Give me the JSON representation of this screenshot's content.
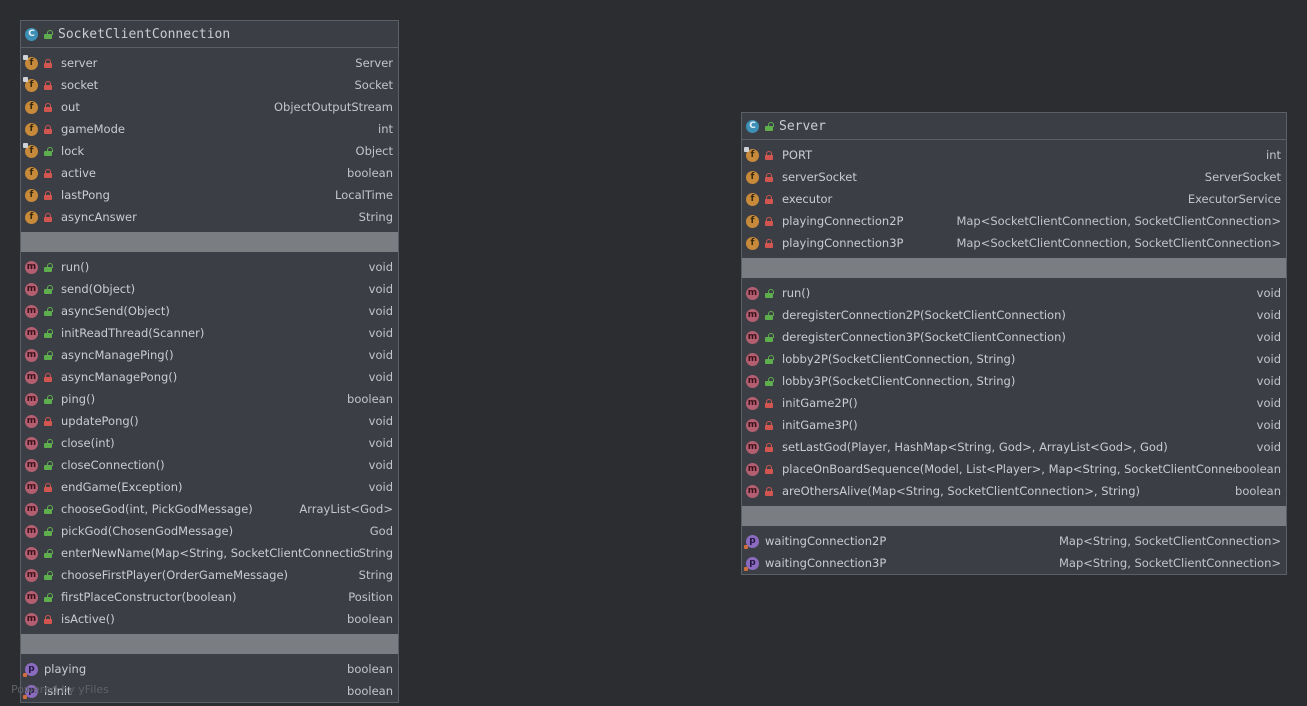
{
  "classes": [
    {
      "name": "SocketClientConnection",
      "fields": [
        {
          "name": "server",
          "type": "Server",
          "visibility": "private",
          "static": true
        },
        {
          "name": "socket",
          "type": "Socket",
          "visibility": "private",
          "static": true
        },
        {
          "name": "out",
          "type": "ObjectOutputStream",
          "visibility": "private"
        },
        {
          "name": "gameMode",
          "type": "int",
          "visibility": "private"
        },
        {
          "name": "lock",
          "type": "Object",
          "visibility": "public",
          "static": true
        },
        {
          "name": "active",
          "type": "boolean",
          "visibility": "private"
        },
        {
          "name": "lastPong",
          "type": "LocalTime",
          "visibility": "private"
        },
        {
          "name": "asyncAnswer",
          "type": "String",
          "visibility": "private"
        }
      ],
      "methods": [
        {
          "name": "run()",
          "type": "void",
          "visibility": "public"
        },
        {
          "name": "send(Object)",
          "type": "void",
          "visibility": "public"
        },
        {
          "name": "asyncSend(Object)",
          "type": "void",
          "visibility": "public"
        },
        {
          "name": "initReadThread(Scanner)",
          "type": "void",
          "visibility": "public"
        },
        {
          "name": "asyncManagePing()",
          "type": "void",
          "visibility": "public"
        },
        {
          "name": "asyncManagePong()",
          "type": "void",
          "visibility": "private"
        },
        {
          "name": "ping()",
          "type": "boolean",
          "visibility": "public"
        },
        {
          "name": "updatePong()",
          "type": "void",
          "visibility": "private"
        },
        {
          "name": "close(int)",
          "type": "void",
          "visibility": "public"
        },
        {
          "name": "closeConnection()",
          "type": "void",
          "visibility": "public"
        },
        {
          "name": "endGame(Exception)",
          "type": "void",
          "visibility": "private"
        },
        {
          "name": "chooseGod(int, PickGodMessage)",
          "type": "ArrayList<God>",
          "visibility": "public"
        },
        {
          "name": "pickGod(ChosenGodMessage)",
          "type": "God",
          "visibility": "public"
        },
        {
          "name": "enterNewName(Map<String, SocketClientConnection>)",
          "type": "String",
          "visibility": "public"
        },
        {
          "name": "chooseFirstPlayer(OrderGameMessage)",
          "type": "String",
          "visibility": "public"
        },
        {
          "name": "firstPlaceConstructor(boolean)",
          "type": "Position",
          "visibility": "public"
        },
        {
          "name": "isActive()",
          "type": "boolean",
          "visibility": "private"
        }
      ],
      "properties": [
        {
          "name": "playing",
          "type": "boolean"
        },
        {
          "name": "isInit",
          "type": "boolean"
        }
      ]
    },
    {
      "name": "Server",
      "fields": [
        {
          "name": "PORT",
          "type": "int",
          "visibility": "private",
          "static": true
        },
        {
          "name": "serverSocket",
          "type": "ServerSocket",
          "visibility": "private"
        },
        {
          "name": "executor",
          "type": "ExecutorService",
          "visibility": "private"
        },
        {
          "name": "playingConnection2P",
          "type": "Map<SocketClientConnection, SocketClientConnection>",
          "visibility": "private"
        },
        {
          "name": "playingConnection3P",
          "type": "Map<SocketClientConnection, SocketClientConnection>",
          "visibility": "private"
        }
      ],
      "methods": [
        {
          "name": "run()",
          "type": "void",
          "visibility": "public"
        },
        {
          "name": "deregisterConnection2P(SocketClientConnection)",
          "type": "void",
          "visibility": "public"
        },
        {
          "name": "deregisterConnection3P(SocketClientConnection)",
          "type": "void",
          "visibility": "public"
        },
        {
          "name": "lobby2P(SocketClientConnection, String)",
          "type": "void",
          "visibility": "public"
        },
        {
          "name": "lobby3P(SocketClientConnection, String)",
          "type": "void",
          "visibility": "public"
        },
        {
          "name": "initGame2P()",
          "type": "void",
          "visibility": "private"
        },
        {
          "name": "initGame3P()",
          "type": "void",
          "visibility": "private"
        },
        {
          "name": "setLastGod(Player, HashMap<String, God>, ArrayList<God>, God)",
          "type": "void",
          "visibility": "private"
        },
        {
          "name": "placeOnBoardSequence(Model, List<Player>, Map<String, SocketClientConnection>)",
          "type": "boolean",
          "visibility": "private"
        },
        {
          "name": "areOthersAlive(Map<String, SocketClientConnection>, String)",
          "type": "boolean",
          "visibility": "private"
        }
      ],
      "properties": [
        {
          "name": "waitingConnection2P",
          "type": "Map<String, SocketClientConnection>"
        },
        {
          "name": "waitingConnection3P",
          "type": "Map<String, SocketClientConnection>"
        }
      ]
    }
  ],
  "icons": {
    "class": "C",
    "field": "f",
    "method": "m",
    "property": "p"
  },
  "watermark": "Powered by yFiles",
  "colors": {
    "background": "#2b2d30",
    "node": "#3b3f45",
    "separator": "#7a7d82",
    "class_icon": "#3d8fb6",
    "field_icon": "#c68a3a",
    "method_icon": "#b45f71",
    "property_icon": "#8a6bbf",
    "private": "#d2564f",
    "public": "#5fae4e"
  }
}
